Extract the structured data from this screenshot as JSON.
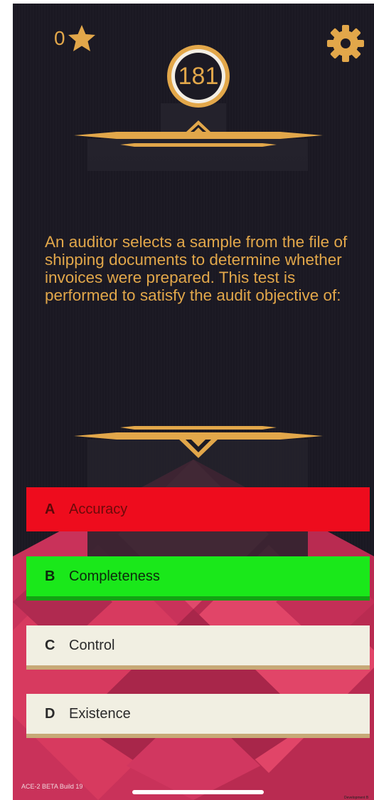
{
  "hud": {
    "star_count": "0",
    "timer_value": "181",
    "star_icon": "star-icon",
    "settings_icon": "gear-icon"
  },
  "question": {
    "text": "An auditor selects a sample from the file of shipping documents to determine whether invoices were prepared. This test is performed to satisfy the audit objective of:"
  },
  "answers": [
    {
      "letter": "A",
      "label": "Accuracy",
      "state": "incorrect"
    },
    {
      "letter": "B",
      "label": "Completeness",
      "state": "correct"
    },
    {
      "letter": "C",
      "label": "Control",
      "state": "neutral"
    },
    {
      "letter": "D",
      "label": "Existence",
      "state": "neutral"
    }
  ],
  "footer": {
    "build": "ACE-2 BETA Build 19",
    "dev_tag": "Development B"
  },
  "colors": {
    "gold": "#e2a74a",
    "background": "#1c1a24",
    "pink": "#d73a5f",
    "incorrect": "#ee0c1d",
    "correct": "#1ae81a",
    "neutral": "#f1efe2"
  }
}
